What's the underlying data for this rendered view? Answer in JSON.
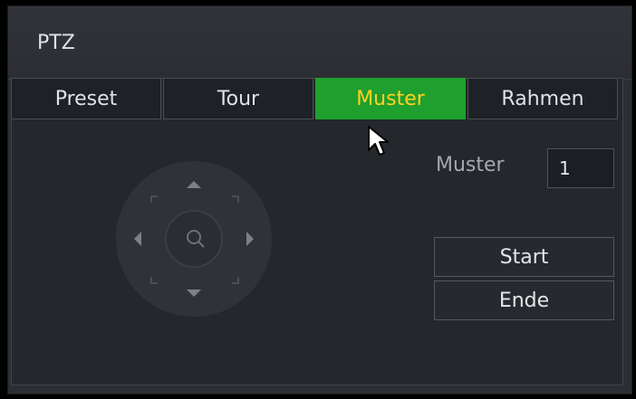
{
  "window": {
    "title": "PTZ"
  },
  "tabs": [
    {
      "label": "Preset",
      "active": false
    },
    {
      "label": "Tour",
      "active": false
    },
    {
      "label": "Muster",
      "active": true
    },
    {
      "label": "Rahmen",
      "active": false
    }
  ],
  "pattern": {
    "label": "Muster",
    "value": "1",
    "start_label": "Start",
    "end_label": "Ende"
  },
  "joystick": {
    "icons": [
      "arrow-up-icon",
      "arrow-down-icon",
      "arrow-left-icon",
      "arrow-right-icon",
      "zoom-lens-icon"
    ]
  },
  "colors": {
    "active_tab_bg": "#1f9f2e",
    "active_tab_text": "#ffd21f",
    "panel_bg": "#2b2e32"
  }
}
